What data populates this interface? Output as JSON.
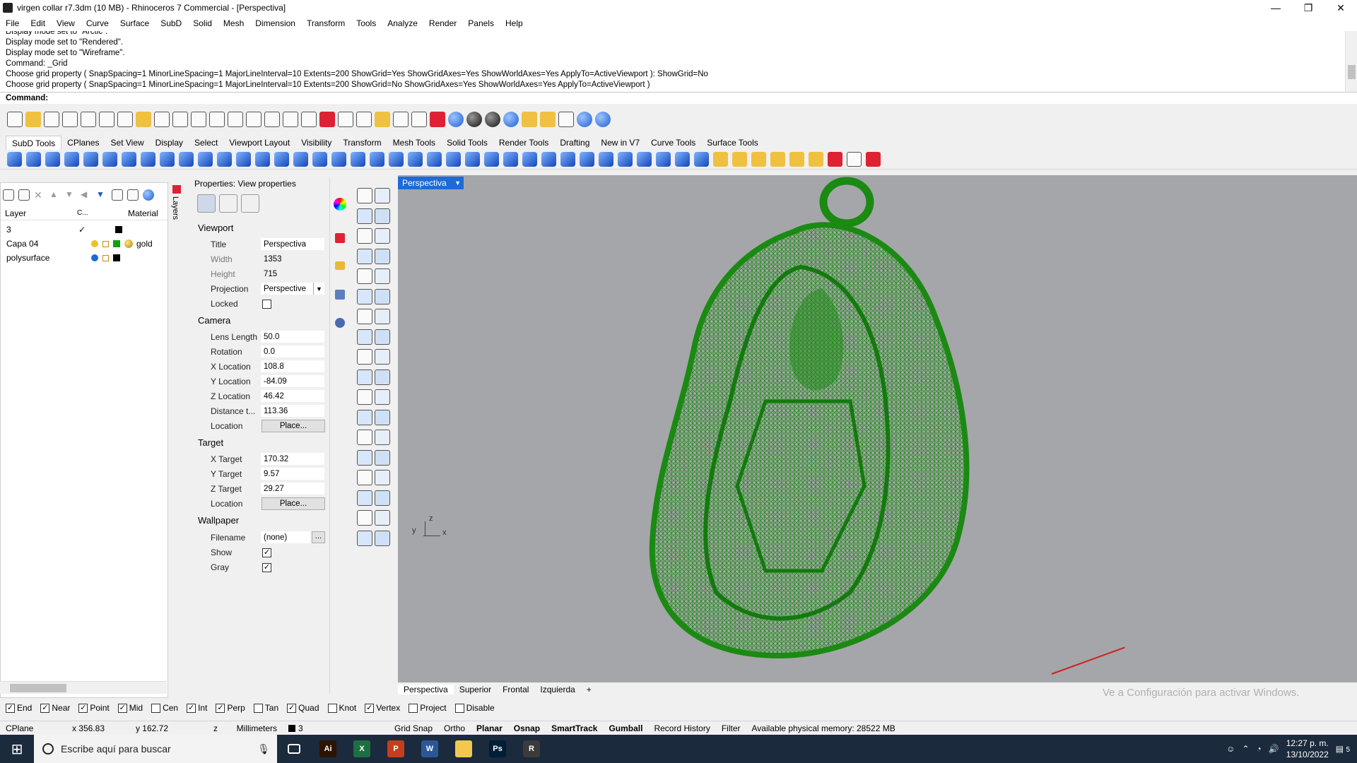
{
  "window": {
    "title": "virgen collar r7.3dm (10 MB) - Rhinoceros 7 Commercial - [Perspectiva]",
    "minimize": "—",
    "restore": "❐",
    "close": "✕"
  },
  "menu": [
    "File",
    "Edit",
    "View",
    "Curve",
    "Surface",
    "SubD",
    "Solid",
    "Mesh",
    "Dimension",
    "Transform",
    "Tools",
    "Analyze",
    "Render",
    "Panels",
    "Help"
  ],
  "history": [
    "Display mode set to \"Arctic\".",
    "Display mode set to \"Rendered\".",
    "Display mode set to \"Wireframe\".",
    "Command: _Grid",
    "Choose grid property ( SnapSpacing=1  MinorLineSpacing=1  MajorLineInterval=10  Extents=200  ShowGrid=Yes  ShowGridAxes=Yes  ShowWorldAxes=Yes  ApplyTo=ActiveViewport ): ShowGrid=No",
    "Choose grid property ( SnapSpacing=1  MinorLineSpacing=1  MajorLineInterval=10  Extents=200  ShowGrid=No  ShowGridAxes=Yes  ShowWorldAxes=Yes  ApplyTo=ActiveViewport )"
  ],
  "command_prompt": "Command:",
  "toolbar_tabs": [
    "SubD Tools",
    "CPlanes",
    "Set View",
    "Display",
    "Select",
    "Viewport Layout",
    "Visibility",
    "Transform",
    "Mesh Tools",
    "Solid Tools",
    "Render Tools",
    "Drafting",
    "New in V7",
    "Curve Tools",
    "Surface Tools"
  ],
  "layers": {
    "header": {
      "name": "Layer",
      "current": "C...",
      "material": "Material"
    },
    "rows": [
      {
        "name": "3",
        "current": "✓",
        "color": "#000000",
        "material": ""
      },
      {
        "name": "Capa 04",
        "current": "",
        "color": "#10a010",
        "material": "gold"
      },
      {
        "name": "polysurface",
        "current": "",
        "color": "#000000",
        "material": ""
      }
    ],
    "side_tab": "Layers"
  },
  "properties": {
    "title": "Properties: View properties",
    "viewport_section": "Viewport",
    "title_label": "Title",
    "title_value": "Perspectiva",
    "width_label": "Width",
    "width_value": "1353",
    "height_label": "Height",
    "height_value": "715",
    "projection_label": "Projection",
    "projection_value": "Perspective",
    "locked_label": "Locked",
    "camera_section": "Camera",
    "lens_label": "Lens Length",
    "lens_value": "50.0",
    "rotation_label": "Rotation",
    "rotation_value": "0.0",
    "xloc_label": "X Location",
    "xloc_value": "108.8",
    "yloc_label": "Y Location",
    "yloc_value": "-84.09",
    "zloc_label": "Z Location",
    "zloc_value": "46.42",
    "dist_label": "Distance t...",
    "dist_value": "113.36",
    "location_label": "Location",
    "place_label": "Place...",
    "target_section": "Target",
    "xt_label": "X Target",
    "xt_value": "170.32",
    "yt_label": "Y Target",
    "yt_value": "9.57",
    "zt_label": "Z Target",
    "zt_value": "29.27",
    "tlocation_label": "Location",
    "tplace_label": "Place...",
    "wallpaper_section": "Wallpaper",
    "filename_label": "Filename",
    "filename_value": "(none)",
    "browse": "...",
    "show_label": "Show",
    "gray_label": "Gray",
    "check": "✓"
  },
  "viewport": {
    "active_tab": "Perspectiva",
    "axis_z": "z",
    "axis_y": "y",
    "axis_x": "x",
    "model_color": "#1a8a12",
    "background": "#a5a6a9"
  },
  "viewport_tabs": [
    "Perspectiva",
    "Superior",
    "Frontal",
    "Izquierda",
    "+"
  ],
  "watermark": "Ve a Configuración para activar Windows.",
  "osnaps": [
    {
      "label": "End",
      "on": true
    },
    {
      "label": "Near",
      "on": true
    },
    {
      "label": "Point",
      "on": true
    },
    {
      "label": "Mid",
      "on": true
    },
    {
      "label": "Cen",
      "on": false
    },
    {
      "label": "Int",
      "on": true
    },
    {
      "label": "Perp",
      "on": true
    },
    {
      "label": "Tan",
      "on": false
    },
    {
      "label": "Quad",
      "on": true
    },
    {
      "label": "Knot",
      "on": false
    },
    {
      "label": "Vertex",
      "on": true
    },
    {
      "label": "Project",
      "on": false
    },
    {
      "label": "Disable",
      "on": false
    }
  ],
  "status": {
    "cplane": "CPlane",
    "x": "x 356.83",
    "y": "y 162.72",
    "z": "z",
    "units": "Millimeters",
    "layer": "3",
    "grid_snap": "Grid Snap",
    "ortho": "Ortho",
    "planar": "Planar",
    "osnap": "Osnap",
    "smarttrack": "SmartTrack",
    "gumball": "Gumball",
    "record_history": "Record History",
    "filter": "Filter",
    "memory": "Available physical memory: 28522 MB"
  },
  "taskbar": {
    "search_placeholder": "Escribe aquí para buscar",
    "time": "12:27 p. m.",
    "date": "13/10/2022",
    "notif_count": "5",
    "apps": [
      {
        "name": "Illustrator",
        "glyph": "Ai",
        "color": "#2d1400"
      },
      {
        "name": "Excel",
        "glyph": "X",
        "color": "#1d6f42"
      },
      {
        "name": "PowerPoint",
        "glyph": "P",
        "color": "#c43e1c"
      },
      {
        "name": "Word",
        "glyph": "W",
        "color": "#2b579a"
      },
      {
        "name": "File Explorer",
        "glyph": "",
        "color": "#f2c94c"
      },
      {
        "name": "Photoshop",
        "glyph": "Ps",
        "color": "#001e36"
      },
      {
        "name": "Rhinoceros",
        "glyph": "R",
        "color": "#3b3b3b"
      }
    ]
  }
}
